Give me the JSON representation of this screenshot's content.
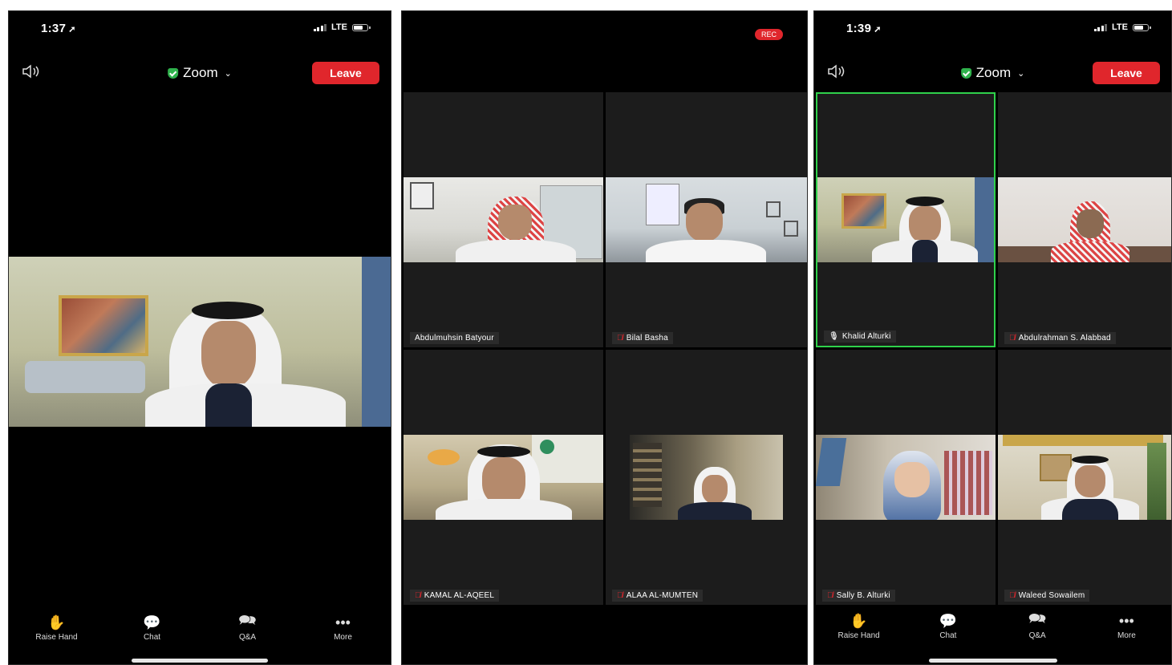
{
  "phone1": {
    "status": {
      "time": "1:37",
      "network": "LTE"
    },
    "topbar": {
      "title": "Zoom",
      "leave_label": "Leave"
    },
    "toolbar": [
      {
        "label": "Raise Hand",
        "icon": "raise-hand-icon"
      },
      {
        "label": "Chat",
        "icon": "chat-icon"
      },
      {
        "label": "Q&A",
        "icon": "qa-icon"
      },
      {
        "label": "More",
        "icon": "more-icon"
      }
    ]
  },
  "phone2": {
    "rec_label": "REC",
    "participants": [
      {
        "name": "Abdulmuhsin Batyour",
        "muted": false
      },
      {
        "name": "Bilal Basha",
        "muted": true
      },
      {
        "name": "KAMAL AL-AQEEL",
        "muted": true
      },
      {
        "name": "ALAA AL-MUMTEN",
        "muted": true
      }
    ]
  },
  "phone3": {
    "status": {
      "time": "1:39",
      "network": "LTE"
    },
    "topbar": {
      "title": "Zoom",
      "leave_label": "Leave"
    },
    "participants": [
      {
        "name": "Khalid Alturki",
        "muted": false,
        "active": true
      },
      {
        "name": "Abdulrahman S. Alabbad",
        "muted": true
      },
      {
        "name": "Sally B. Alturki",
        "muted": true
      },
      {
        "name": "Waleed Sowailem",
        "muted": true
      }
    ],
    "toolbar": [
      {
        "label": "Raise Hand",
        "icon": "raise-hand-icon"
      },
      {
        "label": "Chat",
        "icon": "chat-icon"
      },
      {
        "label": "Q&A",
        "icon": "qa-icon"
      },
      {
        "label": "More",
        "icon": "more-icon"
      }
    ]
  },
  "colors": {
    "leave": "#e0262c",
    "active_border": "#2fd14b",
    "shield": "#2fb24c",
    "muted_mic": "#e0262c"
  }
}
